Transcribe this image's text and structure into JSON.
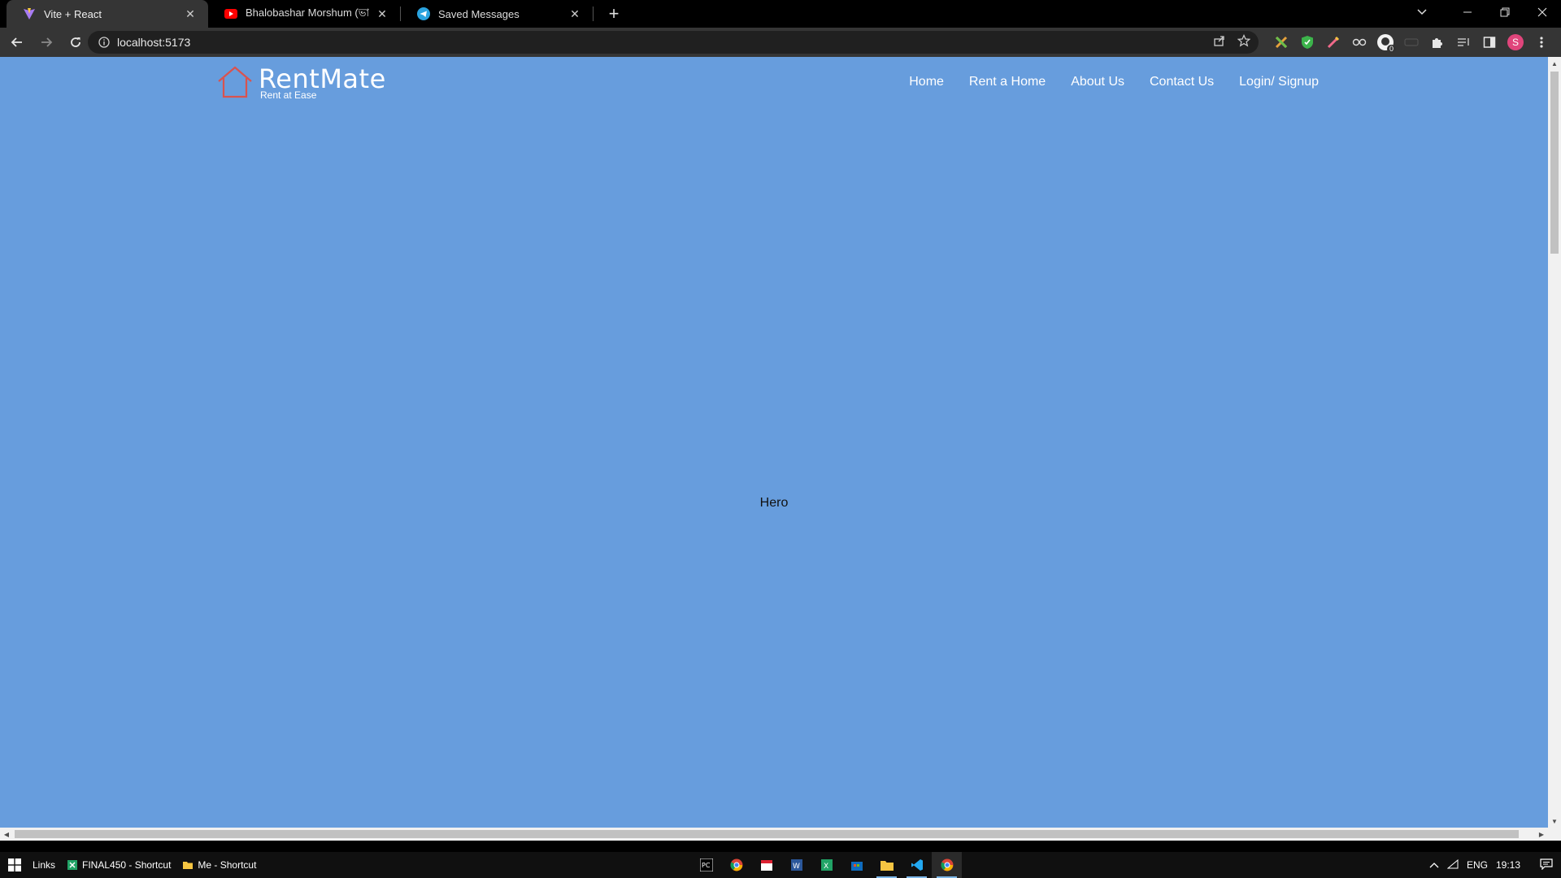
{
  "browser": {
    "tabs": [
      {
        "title": "Vite + React",
        "active": true,
        "favicon": "vite-icon"
      },
      {
        "title": "Bhalobashar Morshum (ভালবাসা…",
        "active": false,
        "favicon": "youtube-icon"
      },
      {
        "title": "Saved Messages",
        "active": false,
        "favicon": "telegram-icon"
      }
    ],
    "new_tab_label": "+",
    "url": "localhost:5173",
    "profile_initial": "S",
    "extension_badge": "0"
  },
  "site": {
    "brand": "RentMate",
    "tagline": "Rent at Ease",
    "nav": [
      "Home",
      "Rent a Home",
      "About Us",
      "Contact Us",
      "Login/ Signup"
    ],
    "hero_text": "Hero",
    "background_color": "#679ddd",
    "logo_color": "#d9534f"
  },
  "taskbar": {
    "links_label": "Links",
    "pinned": [
      {
        "label": "FINAL450 - Shortcut",
        "icon": "spreadsheet-icon"
      },
      {
        "label": "Me - Shortcut",
        "icon": "folder-icon"
      }
    ],
    "language": "ENG",
    "time": "19:13"
  }
}
